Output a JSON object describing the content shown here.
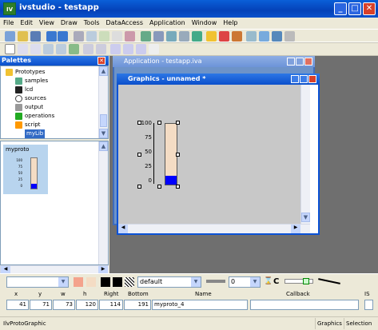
{
  "app": {
    "title": "ivstudio - testapp",
    "icon_label": "IV"
  },
  "menu": [
    "File",
    "Edit",
    "View",
    "Draw",
    "Tools",
    "DataAccess",
    "Application",
    "Window",
    "Help"
  ],
  "palettes": {
    "title": "Palettes",
    "tree_root": "Prototypes",
    "tree_items": [
      "samples",
      "lcd",
      "sources",
      "output",
      "operations",
      "script",
      "myLib"
    ],
    "selected_item": "myLib",
    "proto_name": "myproto",
    "proto_ticks": [
      "100",
      "75",
      "50",
      "25",
      "0"
    ]
  },
  "app_window": {
    "title": "Application - testapp.iva"
  },
  "graphics_window": {
    "title": "Graphics - unnamed *",
    "gauge_ticks": [
      "100",
      "75",
      "50",
      "25",
      "0"
    ],
    "gauge_value": 15,
    "gauge_max": 100
  },
  "bottom_toolbar": {
    "style_combo": "default",
    "linewidth_combo": "0"
  },
  "inspector": {
    "headers": [
      "x",
      "y",
      "w",
      "h",
      "Right",
      "Bottom",
      "Name",
      "Callback",
      "IS"
    ],
    "x": "41",
    "y": "71",
    "w": "73",
    "h": "120",
    "right": "114",
    "bottom": "191",
    "name": "myproto_4",
    "callback": ""
  },
  "status": {
    "left": "IlvProtoGraphic",
    "mode": "Graphics",
    "selection": "Selection"
  },
  "colors": {
    "titlebar": "#0441b8",
    "gauge_fill": "#0000ff",
    "gauge_bg": "#f4dcc4"
  }
}
